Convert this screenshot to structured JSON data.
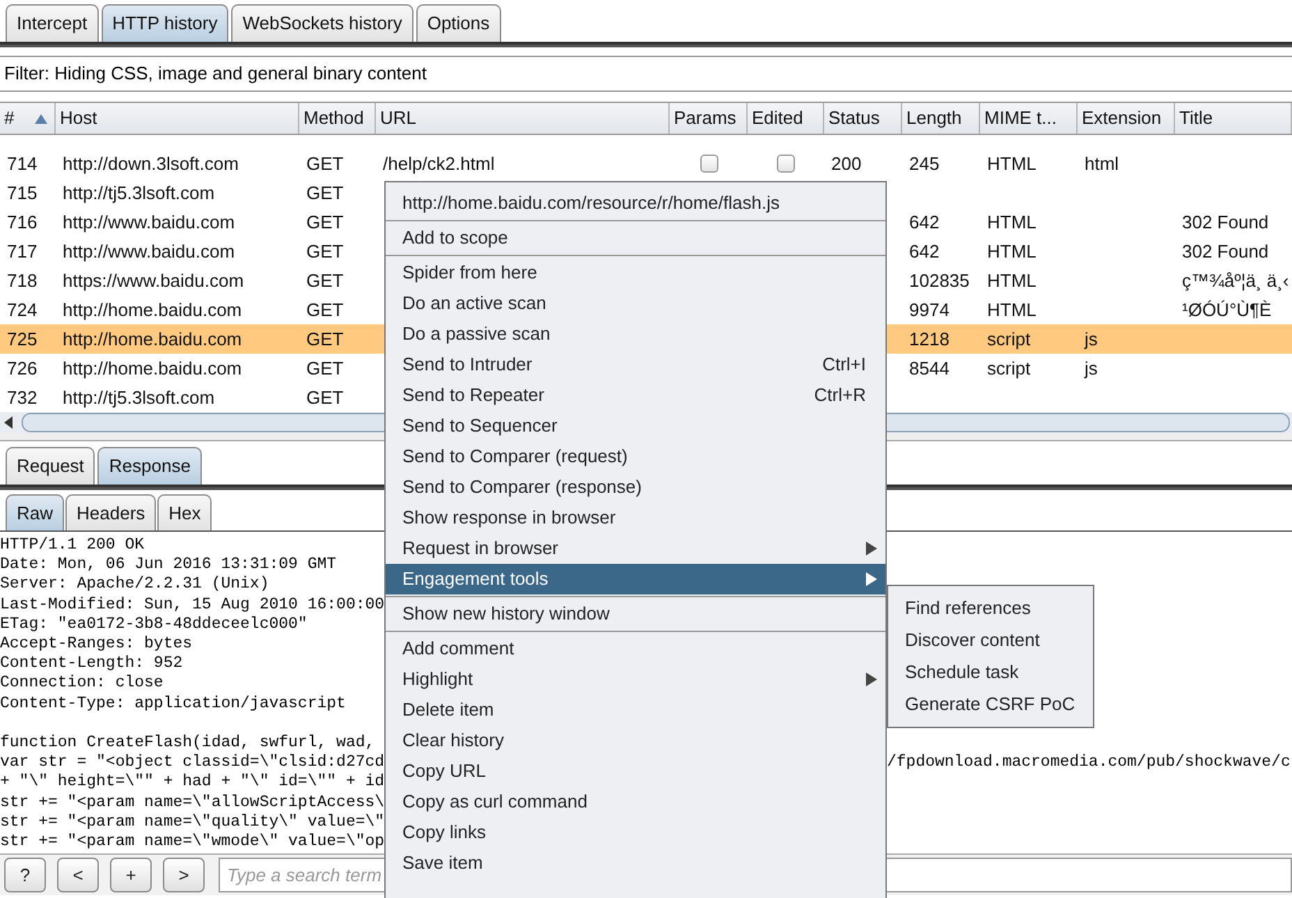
{
  "tabs": [
    {
      "label": "Intercept",
      "selected": false
    },
    {
      "label": "HTTP history",
      "selected": true
    },
    {
      "label": "WebSockets history",
      "selected": false
    },
    {
      "label": "Options",
      "selected": false
    }
  ],
  "filter": "Filter: Hiding CSS, image and general binary content",
  "table": {
    "columns": [
      {
        "label": "#",
        "sorted": true
      },
      {
        "label": "Host",
        "sorted": false
      },
      {
        "label": "Method",
        "sorted": false
      },
      {
        "label": "URL",
        "sorted": false
      },
      {
        "label": "Params",
        "sorted": false
      },
      {
        "label": "Edited",
        "sorted": false
      },
      {
        "label": "Status",
        "sorted": false
      },
      {
        "label": "Length",
        "sorted": false
      },
      {
        "label": "MIME t...",
        "sorted": false
      },
      {
        "label": "Extension",
        "sorted": false
      },
      {
        "label": "Title",
        "sorted": false
      }
    ],
    "rows": [
      {
        "num": "714",
        "host": "http://down.3lsoft.com",
        "method": "GET",
        "url": "/help/ck2.html",
        "params": false,
        "edited": false,
        "status": "200",
        "length": "245",
        "mime": "HTML",
        "extension": "html",
        "selected": false
      },
      {
        "num": "715",
        "host": "http://tj5.3lsoft.com",
        "method": "GET",
        "selected": false
      },
      {
        "num": "716",
        "host": "http://www.baidu.com",
        "method": "GET",
        "length": "642",
        "mime": "HTML",
        "title": "302 Found",
        "selected": false
      },
      {
        "num": "717",
        "host": "http://www.baidu.com",
        "method": "GET",
        "length": "642",
        "mime": "HTML",
        "title": "302 Found",
        "selected": false
      },
      {
        "num": "718",
        "host": "https://www.baidu.com",
        "method": "GET",
        "length": "102835",
        "mime": "HTML",
        "title": "ç™¾åº¦ä¸ ä¸‹",
        "selected": false
      },
      {
        "num": "724",
        "host": "http://home.baidu.com",
        "method": "GET",
        "length": "9974",
        "mime": "HTML",
        "title": "¹ØÓÚ°Ù¶È",
        "selected": false
      },
      {
        "num": "725",
        "host": "http://home.baidu.com",
        "method": "GET",
        "length": "1218",
        "mime": "script",
        "extension": "js",
        "selected": true
      },
      {
        "num": "726",
        "host": "http://home.baidu.com",
        "method": "GET",
        "length": "8544",
        "mime": "script",
        "extension": "js",
        "selected": false
      },
      {
        "num": "732",
        "host": "http://tj5.3lsoft.com",
        "method": "GET",
        "selected": false
      }
    ]
  },
  "message_tabs": [
    {
      "label": "Request",
      "selected": false
    },
    {
      "label": "Response",
      "selected": true
    }
  ],
  "view_tabs": [
    {
      "label": "Raw",
      "selected": true
    },
    {
      "label": "Headers",
      "selected": false
    },
    {
      "label": "Hex",
      "selected": false
    }
  ],
  "response": {
    "header_lines": [
      "HTTP/1.1 200 OK",
      "Date: Mon, 06 Jun 2016 13:31:09 GMT",
      "Server: Apache/2.2.31 (Unix)",
      "Last-Modified: Sun, 15 Aug 2010 16:00:00",
      "ETag: \"ea0172-3b8-48ddeceelc000\"",
      "Accept-Ranges: bytes",
      "Content-Length: 952",
      "Connection: close",
      "Content-Type: application/javascript"
    ],
    "body_lines": [
      "function CreateFlash(idad, swfurl, wad,",
      "var str = \"<object classid=\\\"clsid:d27cd",
      "+ \"\\\" height=\\\"\" + had + \"\\\" id=\\\"\" + id",
      "str += \"<param name=\\\"allowScriptAccess\\",
      "str += \"<param name=\\\"quality\\\" value=\\\"",
      "str += \"<param name=\\\"wmode\\\" value=\\\"op"
    ],
    "body_line_2_tail": "/fpdownload.macromedia.com/pub/shockwave/c"
  },
  "search_bar": {
    "buttons": [
      "?",
      "<",
      "+",
      ">"
    ],
    "placeholder": "Type a search term"
  },
  "context_menu": {
    "groups": [
      [
        {
          "kind": "header",
          "label": "http://home.baidu.com/resource/r/home/flash.js",
          "selected": false
        }
      ],
      [
        {
          "kind": "item",
          "label": "Add to scope",
          "selected": false
        }
      ],
      [
        {
          "kind": "item",
          "label": "Spider from here",
          "selected": false
        },
        {
          "kind": "item",
          "label": "Do an active scan",
          "selected": false
        },
        {
          "kind": "item",
          "label": "Do a passive scan",
          "selected": false
        },
        {
          "kind": "item",
          "label": "Send to Intruder",
          "shortcut": "Ctrl+I",
          "selected": false
        },
        {
          "kind": "item",
          "label": "Send to Repeater",
          "shortcut": "Ctrl+R",
          "selected": false
        },
        {
          "kind": "item",
          "label": "Send to Sequencer",
          "selected": false
        },
        {
          "kind": "item",
          "label": "Send to Comparer (request)",
          "selected": false
        },
        {
          "kind": "item",
          "label": "Send to Comparer (response)",
          "selected": false
        },
        {
          "kind": "item",
          "label": "Show response in browser",
          "selected": false
        },
        {
          "kind": "submenu",
          "label": "Request in browser",
          "selected": false
        },
        {
          "kind": "submenu",
          "label": "Engagement tools",
          "selected": true
        }
      ],
      [
        {
          "kind": "item",
          "label": "Show new history window",
          "selected": false
        }
      ],
      [
        {
          "kind": "item",
          "label": "Add comment",
          "selected": false
        },
        {
          "kind": "submenu",
          "label": "Highlight",
          "selected": false
        },
        {
          "kind": "item",
          "label": "Delete item",
          "selected": false
        },
        {
          "kind": "item",
          "label": "Clear history",
          "selected": false
        },
        {
          "kind": "item",
          "label": "Copy URL",
          "selected": false
        },
        {
          "kind": "item",
          "label": "Copy as curl command",
          "selected": false
        },
        {
          "kind": "item",
          "label": "Copy links",
          "selected": false
        },
        {
          "kind": "item",
          "label": "Save item",
          "selected": false
        }
      ]
    ]
  },
  "submenu": [
    "Find references",
    "Discover content",
    "Schedule task",
    "Generate CSRF PoC"
  ]
}
